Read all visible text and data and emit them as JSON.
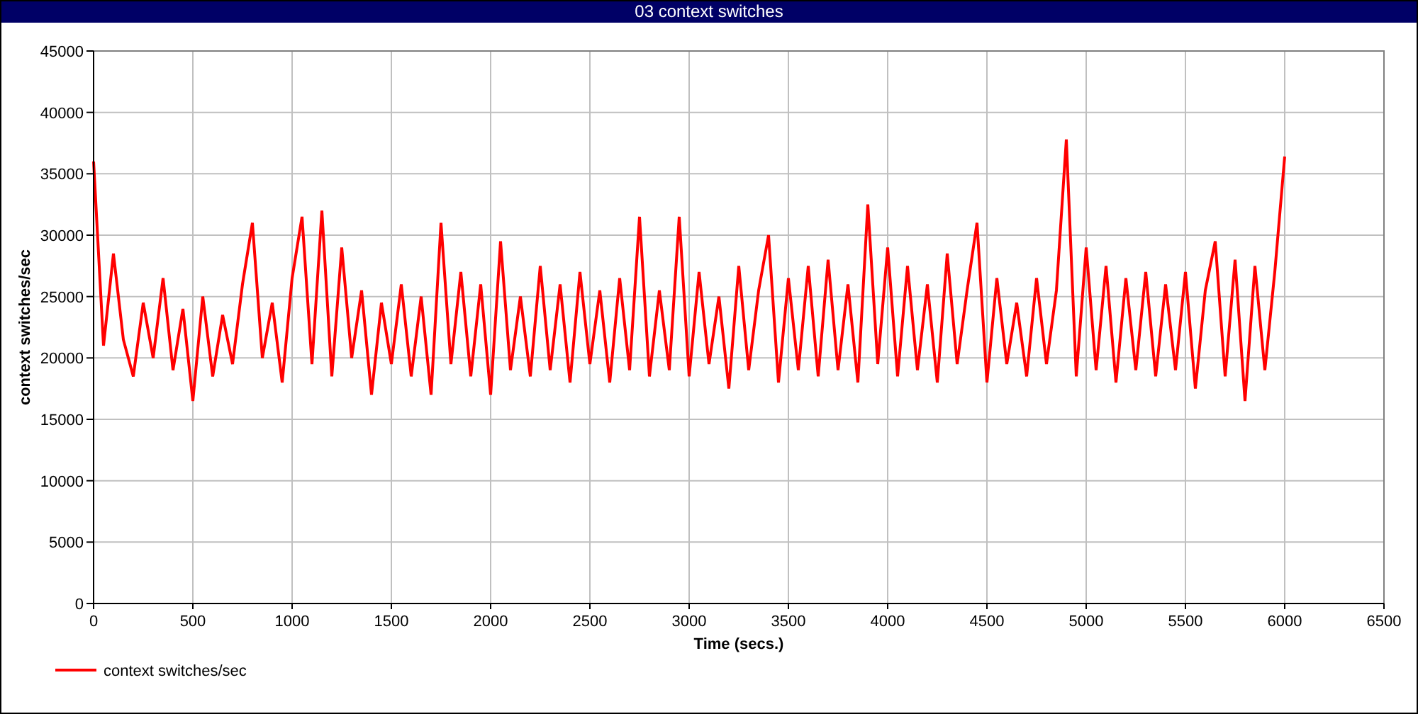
{
  "window": {
    "title": "03 context switches"
  },
  "chart": {
    "chart_data": {
      "type": "line",
      "grid": true,
      "xlabel": "Time (secs.)",
      "ylabel": "context switches/sec",
      "xlim": [
        0,
        6500
      ],
      "ylim": [
        0,
        45000
      ],
      "xticks": [
        0,
        500,
        1000,
        1500,
        2000,
        2500,
        3000,
        3500,
        4000,
        4500,
        5000,
        5500,
        6000,
        6500
      ],
      "yticks": [
        0,
        5000,
        10000,
        15000,
        20000,
        25000,
        30000,
        35000,
        40000,
        45000
      ],
      "x": [
        0,
        50,
        100,
        150,
        200,
        250,
        300,
        350,
        400,
        450,
        500,
        550,
        600,
        650,
        700,
        750,
        800,
        850,
        900,
        950,
        1000,
        1050,
        1100,
        1150,
        1200,
        1250,
        1300,
        1350,
        1400,
        1450,
        1500,
        1550,
        1600,
        1650,
        1700,
        1750,
        1800,
        1850,
        1900,
        1950,
        2000,
        2050,
        2100,
        2150,
        2200,
        2250,
        2300,
        2350,
        2400,
        2450,
        2500,
        2550,
        2600,
        2650,
        2700,
        2750,
        2800,
        2850,
        2900,
        2950,
        3000,
        3050,
        3100,
        3150,
        3200,
        3250,
        3300,
        3350,
        3400,
        3450,
        3500,
        3550,
        3600,
        3650,
        3700,
        3750,
        3800,
        3850,
        3900,
        3950,
        4000,
        4050,
        4100,
        4150,
        4200,
        4250,
        4300,
        4350,
        4400,
        4450,
        4500,
        4550,
        4600,
        4650,
        4700,
        4750,
        4800,
        4850,
        4900,
        4950,
        5000,
        5050,
        5100,
        5150,
        5200,
        5250,
        5300,
        5350,
        5400,
        5450,
        5500,
        5550,
        5600,
        5650,
        5700,
        5750,
        5800,
        5850,
        5900,
        5950,
        6000
      ],
      "series": [
        {
          "name": "context switches/sec",
          "color": "#ff0000",
          "values": [
            36000,
            21000,
            28500,
            21500,
            18500,
            24500,
            20000,
            26500,
            19000,
            24000,
            16500,
            25000,
            18500,
            23500,
            19500,
            26000,
            31000,
            20000,
            24500,
            18000,
            26500,
            31500,
            19500,
            32000,
            18500,
            29000,
            20000,
            25500,
            17000,
            24500,
            19500,
            26000,
            18500,
            25000,
            17000,
            31000,
            19500,
            27000,
            18500,
            26000,
            17000,
            29500,
            19000,
            25000,
            18500,
            27500,
            19000,
            26000,
            18000,
            27000,
            19500,
            25500,
            18000,
            26500,
            19000,
            31500,
            18500,
            25500,
            19000,
            31500,
            18500,
            27000,
            19500,
            25000,
            17500,
            27500,
            19000,
            25500,
            30000,
            18000,
            26500,
            19000,
            27500,
            18500,
            28000,
            19000,
            26000,
            18000,
            32500,
            19500,
            29000,
            18500,
            27500,
            19000,
            26000,
            18000,
            28500,
            19500,
            25500,
            31000,
            18000,
            26500,
            19500,
            24500,
            18500,
            26500,
            19500,
            25500,
            37800,
            18500,
            29000,
            19000,
            27500,
            18000,
            26500,
            19000,
            27000,
            18500,
            26000,
            19000,
            27000,
            17500,
            25500,
            29500,
            18500,
            28000,
            16500,
            27500,
            19000,
            27000,
            36400
          ]
        }
      ]
    }
  }
}
